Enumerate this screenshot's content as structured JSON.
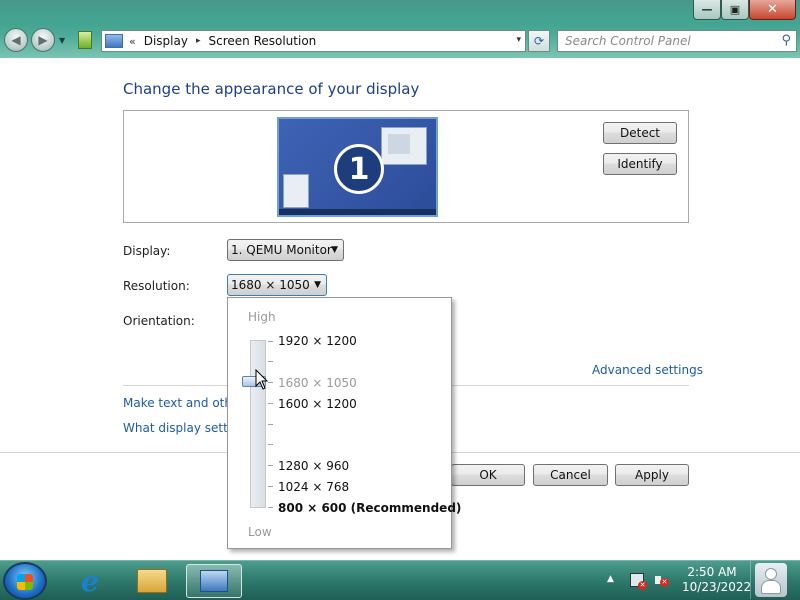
{
  "window": {
    "minimize_glyph": "—",
    "maximize_glyph": "▣",
    "close_glyph": "✕"
  },
  "address_bar": {
    "chevrons": "«",
    "breadcrumbs": [
      "Display",
      "Screen Resolution"
    ],
    "separator": "▸",
    "dropdown_glyph": "▾",
    "refresh_glyph": "⟳"
  },
  "search": {
    "placeholder": "Search Control Panel",
    "icon": "search-icon"
  },
  "page": {
    "title": "Change the appearance of your display",
    "monitor_number": "1"
  },
  "buttons": {
    "detect": "Detect",
    "identify": "Identify",
    "ok": "OK",
    "cancel": "Cancel",
    "apply": "Apply"
  },
  "fields": {
    "display_label": "Display:",
    "display_value": "1. QEMU Monitor",
    "resolution_label": "Resolution:",
    "resolution_value": "1680 × 1050",
    "orientation_label": "Orientation:"
  },
  "links": {
    "advanced": "Advanced settings",
    "make_text": "Make text and other",
    "what_display": "What display setting"
  },
  "resolution_popup": {
    "high_label": "High",
    "low_label": "Low",
    "options": [
      {
        "label": "1920 × 1200",
        "state": "normal"
      },
      {
        "label": "1680 × 1050",
        "state": "current"
      },
      {
        "label": "1600 × 1200",
        "state": "normal"
      },
      {
        "label": "1280 × 960",
        "state": "normal"
      },
      {
        "label": "1024 × 768",
        "state": "normal"
      },
      {
        "label": "800 × 600 (Recommended)",
        "state": "recommended"
      }
    ]
  },
  "taskbar": {
    "items": [
      "start-button",
      "internet-explorer-icon",
      "windows-explorer-icon",
      "control-panel-icon"
    ],
    "tray_expand_glyph": "▲",
    "time": "2:50 AM",
    "date": "10/23/2022"
  }
}
